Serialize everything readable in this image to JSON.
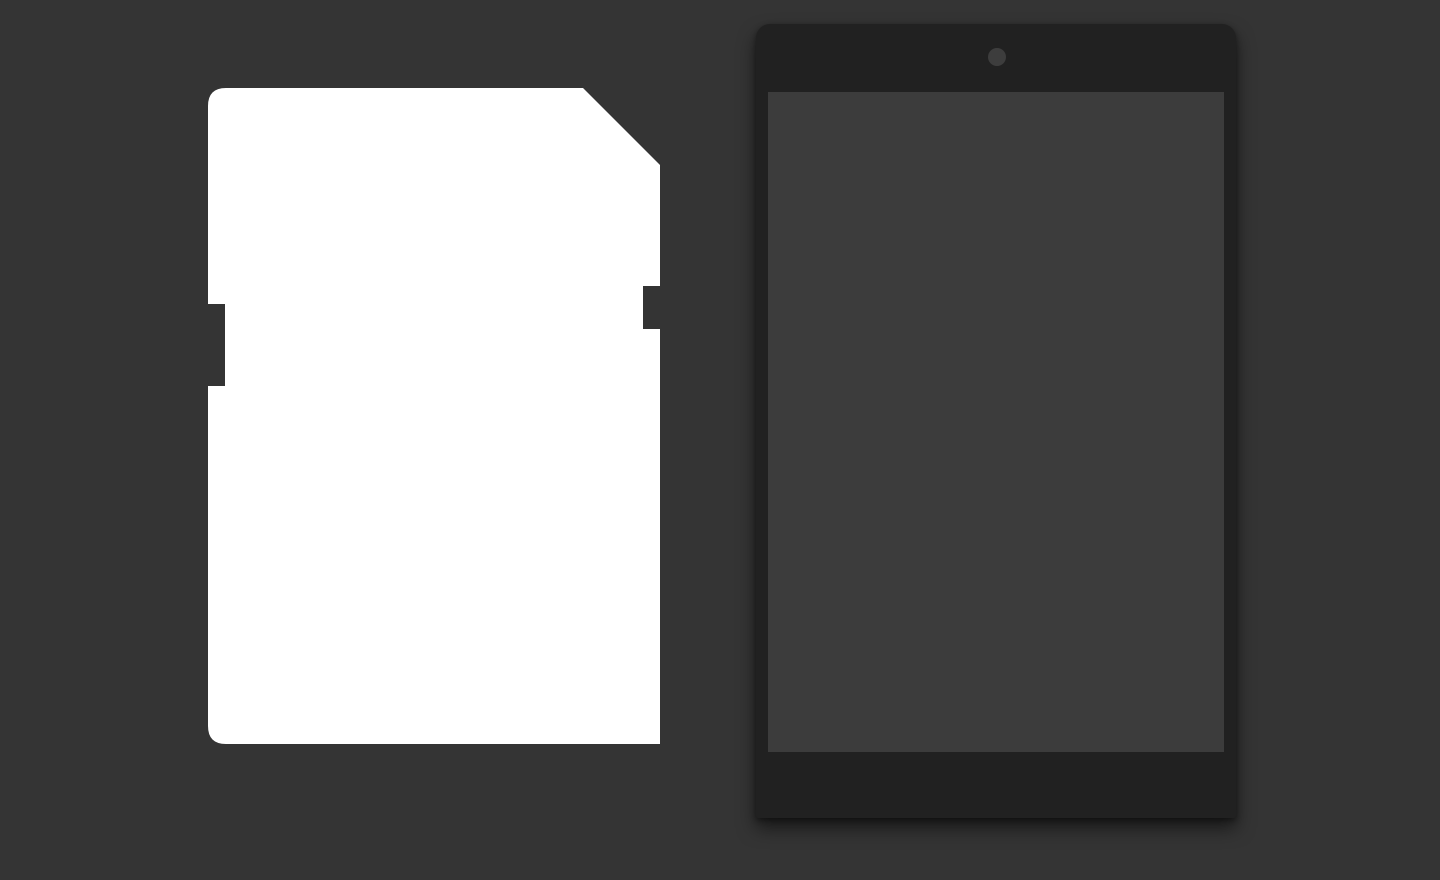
{
  "scene": {
    "background_color": "#343434",
    "sd_card": {
      "icon": "sd-card-icon",
      "fill_color": "#ffffff"
    },
    "tablet": {
      "icon": "tablet-device-icon",
      "body_color": "#212121",
      "screen_color": "#3c3c3c",
      "camera_color": "#3d3d3d"
    }
  }
}
